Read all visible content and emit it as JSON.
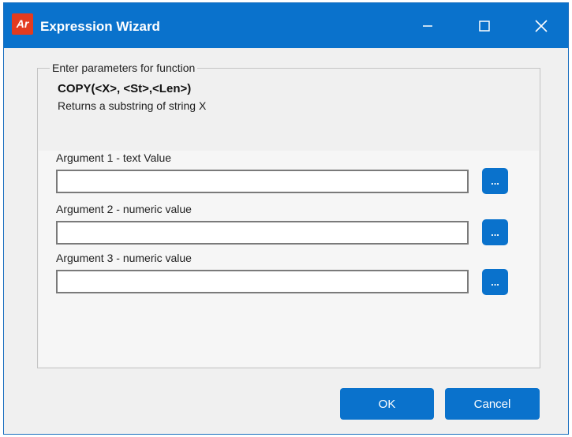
{
  "window": {
    "title": "Expression Wizard",
    "app_icon_text": "Ar",
    "minimize_icon": "minimize-icon",
    "maximize_icon": "maximize-icon",
    "close_icon": "close-icon",
    "accent_color": "#0a72cc"
  },
  "group": {
    "legend": "Enter parameters for function",
    "function_signature": "COPY(<X>, <St>,<Len>)",
    "function_description": "Returns a substring of string X"
  },
  "arguments": [
    {
      "label": "Argument 1 - text Value",
      "value": "",
      "browse_label": "..."
    },
    {
      "label": "Argument 2 - numeric value",
      "value": "",
      "browse_label": "..."
    },
    {
      "label": "Argument 3 - numeric value",
      "value": "",
      "browse_label": "..."
    }
  ],
  "buttons": {
    "ok_label": "OK",
    "cancel_label": "Cancel"
  }
}
